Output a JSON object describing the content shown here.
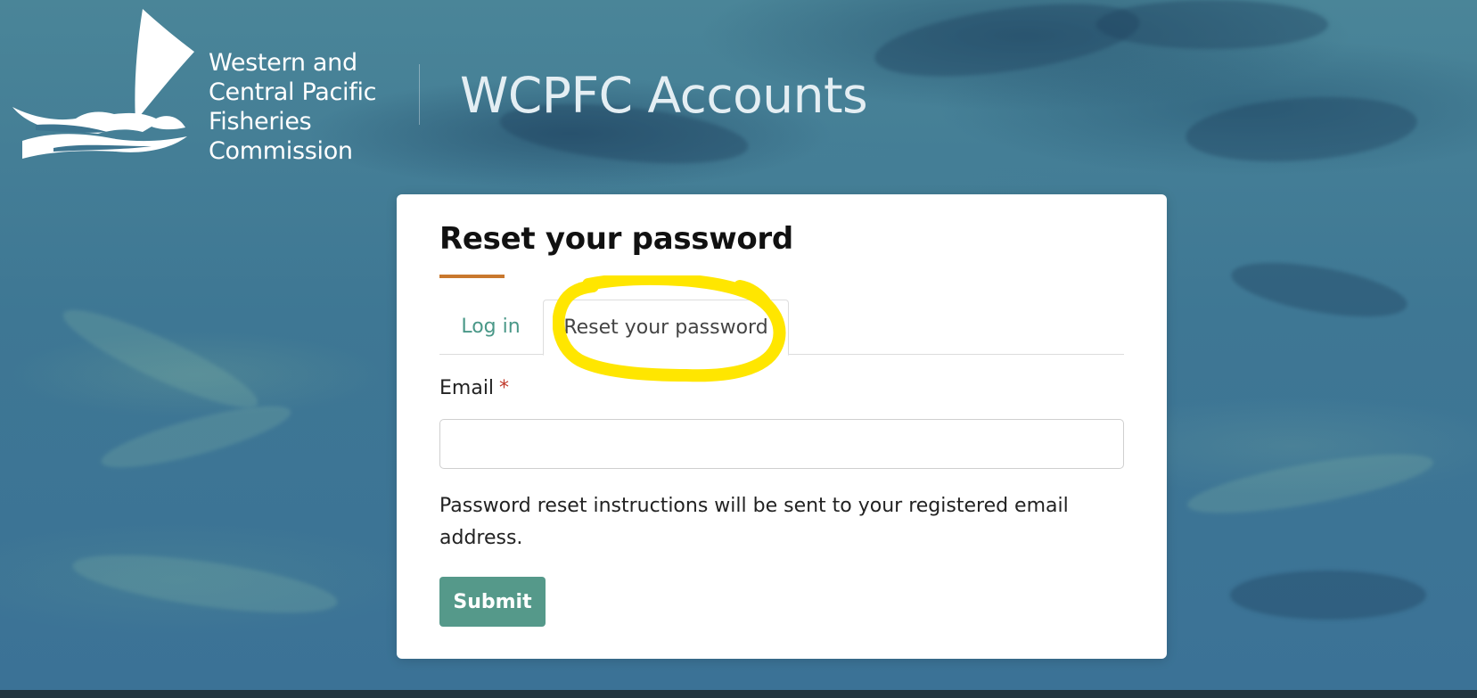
{
  "header": {
    "logo_lines": [
      "Western and",
      "Central Pacific",
      "Fisheries",
      "Commission"
    ],
    "site_title": "WCPFC Accounts",
    "logo_icon": "sail-and-fish-icon"
  },
  "card": {
    "title": "Reset your password",
    "tabs": [
      {
        "label": "Log in",
        "active": false
      },
      {
        "label": "Reset your password",
        "active": true
      }
    ],
    "email_label": "Email",
    "required_mark": "*",
    "email_value": "",
    "help_text": "Password reset instructions will be sent to your registered email address.",
    "submit_label": "Submit"
  },
  "colors": {
    "accent_underline": "#c9782e",
    "tab_link": "#4a9888",
    "submit_button": "#55998a",
    "highlight_annotation": "#ffe600",
    "required": "#c0392b"
  }
}
